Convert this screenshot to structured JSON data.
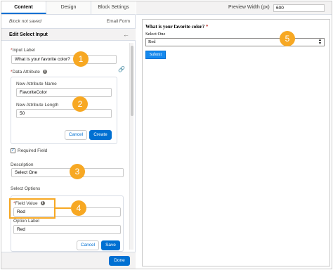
{
  "tabs": [
    "Content",
    "Design",
    "Block Settings"
  ],
  "status": {
    "saved": "Block not saved",
    "form_name": "Email Form"
  },
  "panel": {
    "title": "Edit Select Input",
    "back_icon": "arrow-left-icon"
  },
  "input_label": {
    "label": "Input Label",
    "value": "What is your favorite color?"
  },
  "data_attribute": {
    "label": "Data Attribute",
    "name_label": "New Attribute Name",
    "name_value": "FavoriteColor",
    "length_label": "New Attribute Length",
    "length_value": "50",
    "cancel": "Cancel",
    "create": "Create"
  },
  "required_field": {
    "label": "Required Field",
    "checked": true
  },
  "description": {
    "label": "Description",
    "value": "Select One"
  },
  "select_options": {
    "label": "Select Options",
    "field_value_label": "Field Value",
    "field_value": "Red",
    "option_label_label": "Option Label",
    "option_label_value": "Red",
    "cancel": "Cancel",
    "save": "Save"
  },
  "footer": {
    "done": "Done"
  },
  "preview": {
    "width_label": "Preview Width (px)",
    "width_value": "600",
    "question": "What is your favorite color?",
    "select_label": "Select One",
    "select_value": "Red",
    "submit": "Submit"
  },
  "callouts": [
    "1",
    "2",
    "3",
    "4",
    "5"
  ],
  "colors": {
    "accent": "#0070d2",
    "callout": "#f7a823",
    "required": "#c23934"
  }
}
